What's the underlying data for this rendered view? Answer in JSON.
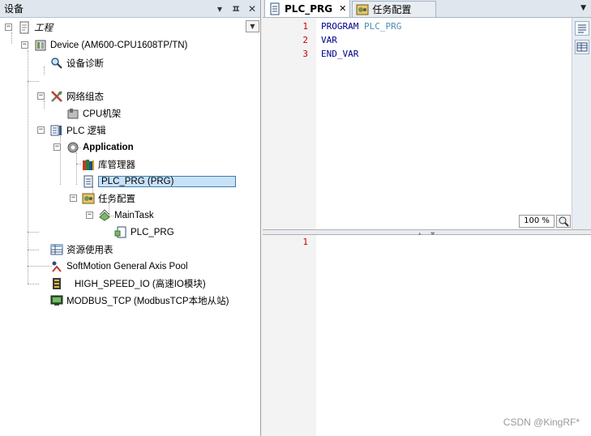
{
  "left_panel": {
    "title": "设备",
    "buttons": {
      "pin_dropdown": "▾",
      "pin": "ㅍ",
      "close": "✕"
    },
    "tree_dropdown": "▼",
    "tree": {
      "project": "工程",
      "device": "Device (AM600-CPU1608TP/TN)",
      "diagnostics": "设备诊断",
      "network_config": "网络组态",
      "cpu_rack": "CPU机架",
      "plc_logic": "PLC 逻辑",
      "application": "Application",
      "library_manager": "库管理器",
      "plc_prg": "PLC_PRG (PRG)",
      "task_config": "任务配置",
      "main_task": "MainTask",
      "main_task_plc_prg": "PLC_PRG",
      "resource_usage": "资源使用表",
      "softmotion_pool": "SoftMotion General Axis Pool",
      "high_speed_io": "HIGH_SPEED_IO (高速IO模块)",
      "modbus_tcp": "MODBUS_TCP (ModbusTCP本地从站)"
    }
  },
  "editor": {
    "tabs": [
      {
        "label": "PLC_PRG",
        "close": "✕"
      },
      {
        "label": "任务配置"
      }
    ],
    "tab_menu_arrow": "▼",
    "declaration": {
      "line_numbers": [
        "1",
        "2",
        "3"
      ],
      "keyword_program": "PROGRAM",
      "program_name": "PLC_PRG",
      "keyword_var": "VAR",
      "keyword_end_var": "END_VAR"
    },
    "zoom": "100 %",
    "implementation": {
      "line_numbers": [
        "1"
      ]
    }
  },
  "watermark": "CSDN @KingRF*"
}
